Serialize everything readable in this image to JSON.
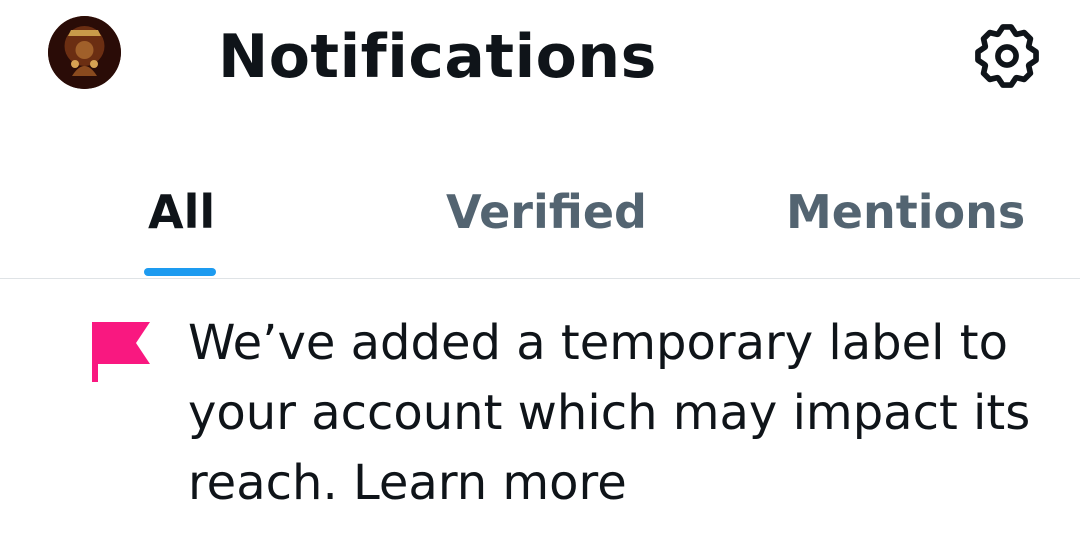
{
  "header": {
    "title": "Notifications",
    "avatar_icon": "profile-avatar",
    "settings_icon": "gear-icon"
  },
  "tabs": [
    {
      "label": "All",
      "active": true
    },
    {
      "label": "Verified",
      "active": false
    },
    {
      "label": "Mentions",
      "active": false
    }
  ],
  "notice": {
    "icon": "flag-icon",
    "icon_color": "#f91880",
    "message": "We’ve added a temporary label to your account which may impact its reach.",
    "link_label": "Learn more"
  },
  "colors": {
    "active_tab_indicator": "#1d9bf0",
    "inactive_tab_text": "#536471",
    "primary_text": "#0f1419"
  }
}
